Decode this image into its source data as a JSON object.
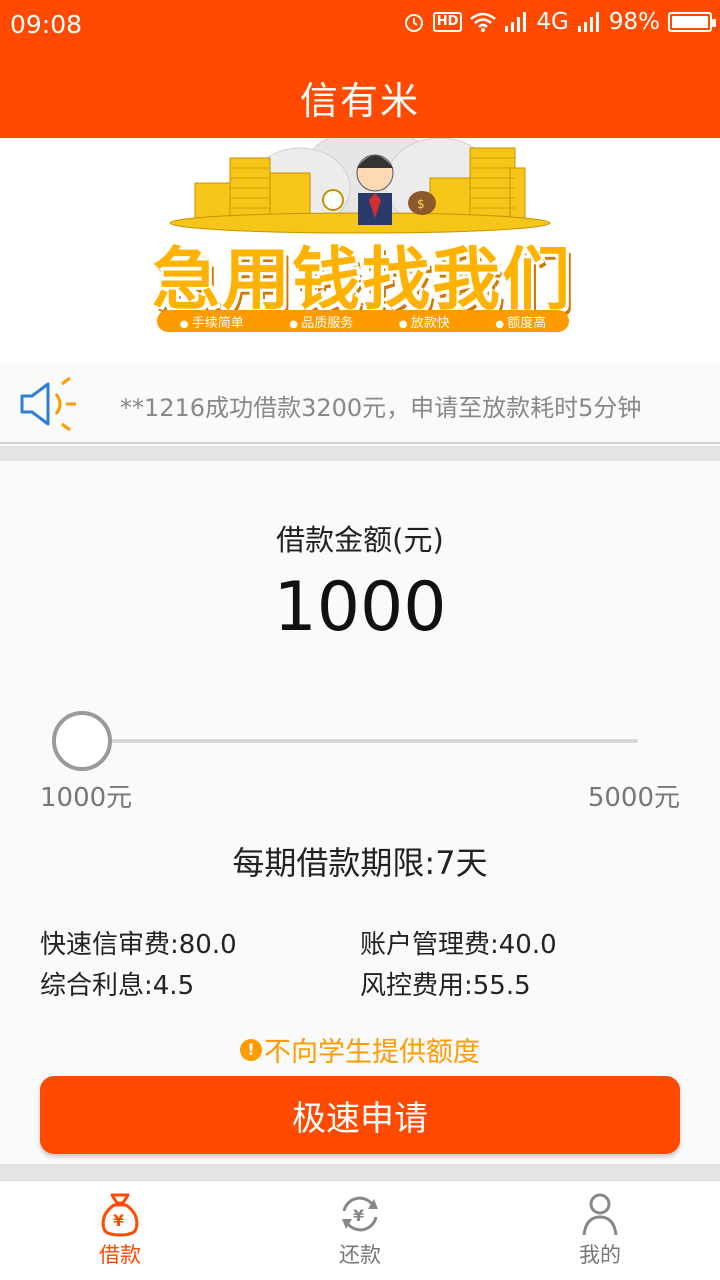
{
  "status_bar": {
    "time": "09:08",
    "hd": "HD",
    "network": "4G",
    "battery": "98%"
  },
  "header": {
    "title": "信有米"
  },
  "banner": {
    "headline": "急用钱找我们",
    "tags": [
      "手续简单",
      "品质服务",
      "放款快",
      "额度高"
    ]
  },
  "notice": {
    "text": "**1216成功借款3200元，申请至放款耗时5分钟"
  },
  "loan": {
    "amount_label": "借款金额(元)",
    "amount_value": "1000",
    "min_label": "1000元",
    "max_label": "5000元",
    "slider_fraction": 0,
    "term": "每期借款期限:7天",
    "fees": [
      "快速信审费:80.0",
      "账户管理费:40.0",
      "综合利息:4.5",
      "风控费用:55.5"
    ],
    "warning_icon": "!",
    "warning": "不向学生提供额度",
    "apply_label": "极速申请"
  },
  "bottom_nav": [
    {
      "label": "借款",
      "icon": "money-bag-icon",
      "active": true
    },
    {
      "label": "还款",
      "icon": "repay-cycle-icon",
      "active": false
    },
    {
      "label": "我的",
      "icon": "user-icon",
      "active": false
    }
  ],
  "colors": {
    "brand": "#ff4a00",
    "warning": "#ff9a00",
    "banner_gold": "#ffb300"
  }
}
